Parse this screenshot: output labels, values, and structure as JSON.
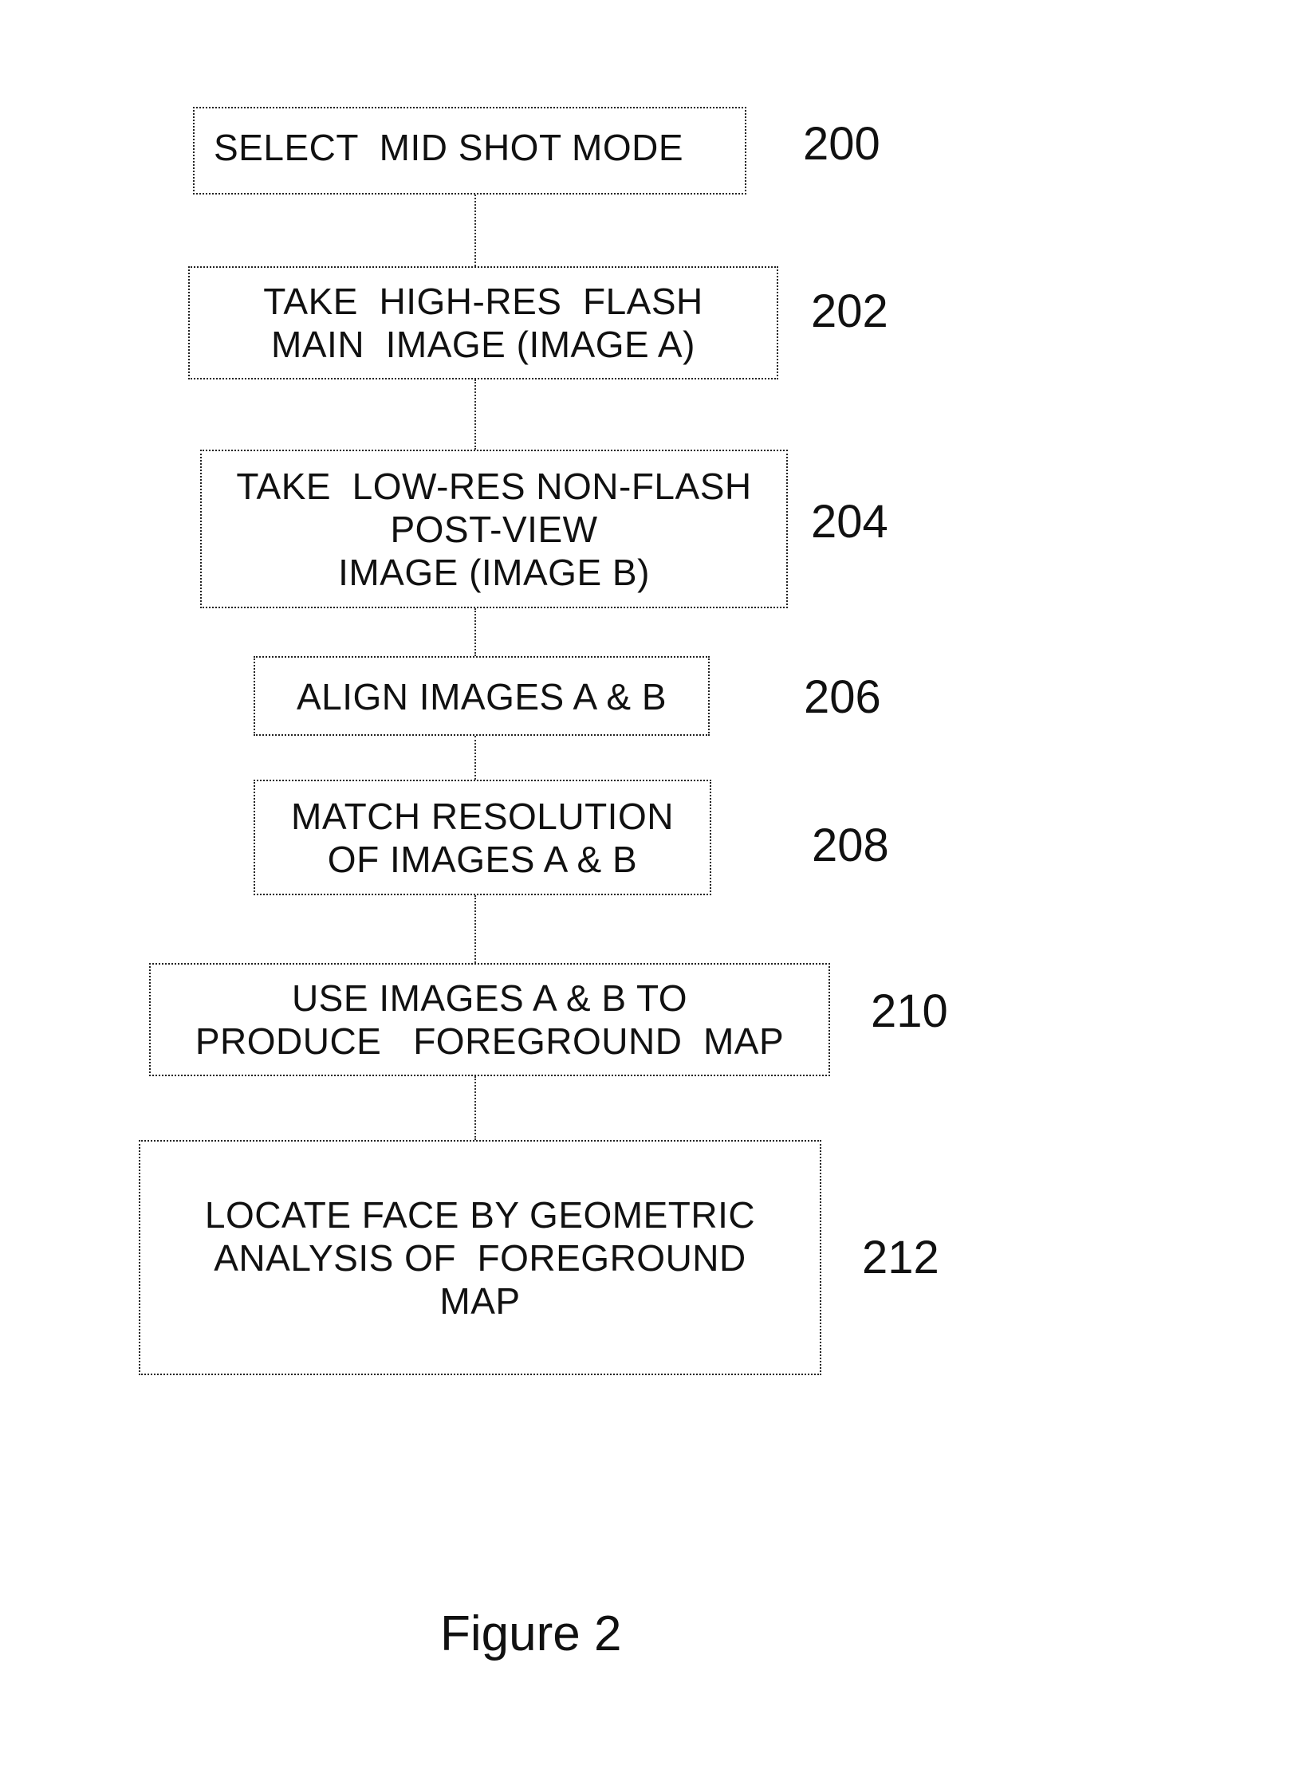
{
  "figure": {
    "caption": "Figure 2",
    "steps": [
      {
        "ref": "200",
        "lines": [
          "SELECT  MID SHOT MODE"
        ]
      },
      {
        "ref": "202",
        "lines": [
          "TAKE  HIGH-RES  FLASH",
          "MAIN  IMAGE (IMAGE A)"
        ]
      },
      {
        "ref": "204",
        "lines": [
          "TAKE  LOW-RES NON-FLASH",
          "POST-VIEW",
          "IMAGE (IMAGE B)"
        ]
      },
      {
        "ref": "206",
        "lines": [
          "ALIGN IMAGES A & B"
        ]
      },
      {
        "ref": "208",
        "lines": [
          "MATCH RESOLUTION",
          "OF IMAGES A & B"
        ]
      },
      {
        "ref": "210",
        "lines": [
          "USE IMAGES A & B TO",
          "PRODUCE   FOREGROUND  MAP"
        ]
      },
      {
        "ref": "212",
        "lines": [
          "LOCATE FACE BY GEOMETRIC",
          "ANALYSIS OF  FOREGROUND",
          "MAP"
        ]
      }
    ],
    "colors": {
      "stroke": "#222222",
      "text": "#111111",
      "background": "#ffffff"
    }
  }
}
